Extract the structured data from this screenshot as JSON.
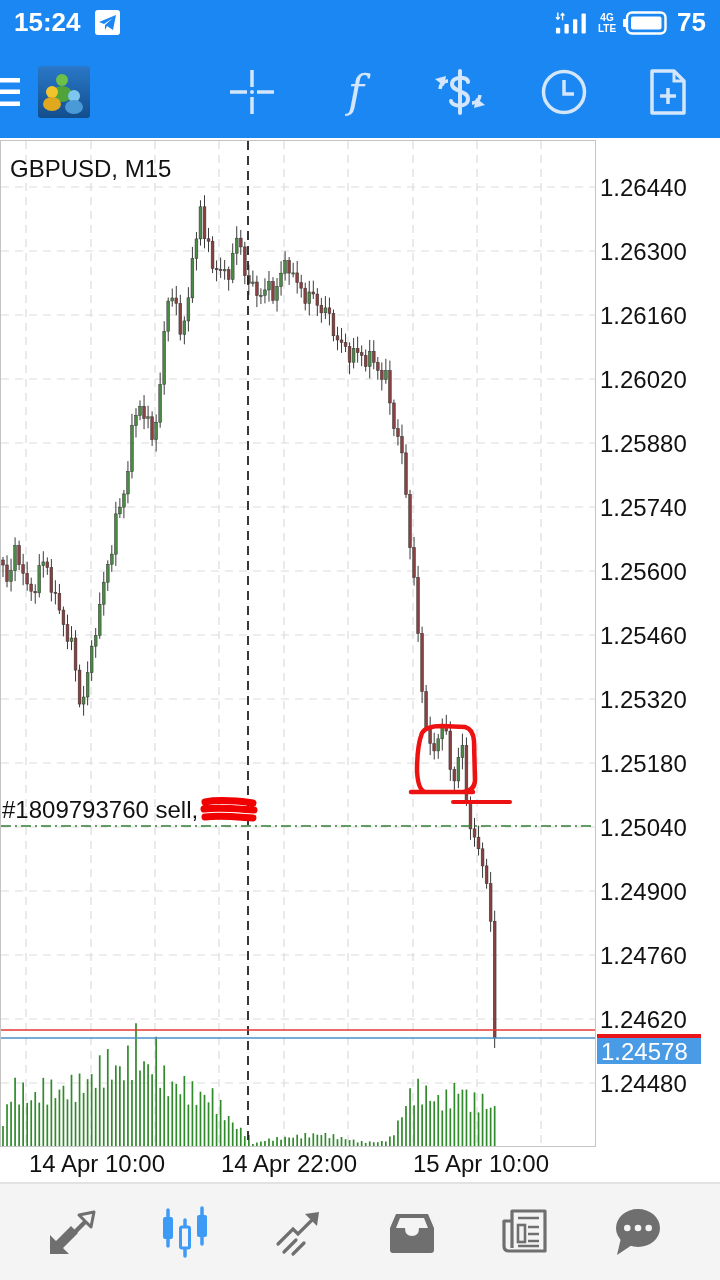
{
  "status_bar": {
    "time": "15:24",
    "network": [
      "4G",
      "LTE"
    ],
    "battery": "75"
  },
  "toolbar": {
    "indicators_button": "f"
  },
  "chart": {
    "title": "GBPUSD, M15",
    "price_labels": [
      "1.26440",
      "1.26300",
      "1.26160",
      "1.26020",
      "1.25880",
      "1.25740",
      "1.25600",
      "1.25460",
      "1.25320",
      "1.25180",
      "1.25040",
      "1.24900",
      "1.24760",
      "1.24620",
      "1.24480"
    ],
    "time_labels": [
      "14 Apr 10:00",
      "14 Apr 22:00",
      "15 Apr 10:00"
    ],
    "order_label": "#1809793760 sell,",
    "bid_tag": "1.24578"
  },
  "bottom_nav": {
    "items": [
      {
        "selected": false
      },
      {
        "selected": true
      },
      {
        "selected": false
      },
      {
        "selected": false
      },
      {
        "selected": false
      },
      {
        "selected": false
      }
    ]
  }
}
